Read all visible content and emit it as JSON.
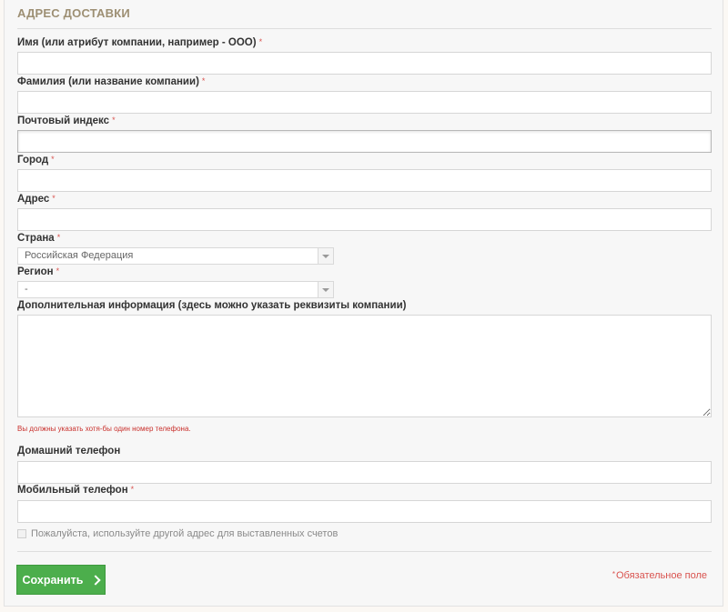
{
  "section": {
    "title": "АДРЕС ДОСТАВКИ"
  },
  "fields": {
    "firstname": {
      "label": "Имя (или атрибут компании, например - ООО)",
      "required_mark": "*",
      "value": ""
    },
    "lastname": {
      "label": "Фамилия (или название компании)",
      "required_mark": "*",
      "value": ""
    },
    "postcode": {
      "label": "Почтовый индекс",
      "required_mark": "*",
      "value": ""
    },
    "city": {
      "label": "Город",
      "required_mark": "*",
      "value": ""
    },
    "address": {
      "label": "Адрес",
      "required_mark": "*",
      "value": ""
    },
    "country": {
      "label": "Страна",
      "required_mark": "*",
      "selected": "Российская Федерация"
    },
    "region": {
      "label": "Регион",
      "required_mark": "*",
      "selected": "-"
    },
    "other": {
      "label": "Дополнительная информация (здесь можно указать реквизиты компании)",
      "value": ""
    },
    "phone_note": "Вы должны указать хотя-бы один номер телефона.",
    "phone": {
      "label": "Домашний телефон",
      "value": ""
    },
    "mobile": {
      "label": "Мобильный телефон",
      "required_mark": "*",
      "value": ""
    }
  },
  "checkbox": {
    "label": "Пожалуйста, используйте другой адрес для выставленных счетов",
    "checked": false
  },
  "actions": {
    "save_label": "Сохранить"
  },
  "required_note": {
    "star": "*",
    "text": "Обязательное поле"
  },
  "colors": {
    "accent": "#4cae4c",
    "required": "#d9534f",
    "title": "#9d8f73"
  }
}
